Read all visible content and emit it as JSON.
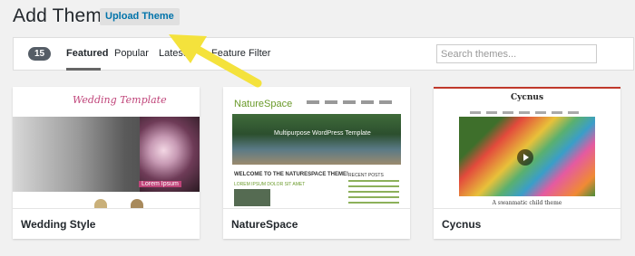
{
  "header": {
    "title": "Add Themes",
    "upload_label": "Upload Theme"
  },
  "filter": {
    "count": "15",
    "tabs": [
      "Featured",
      "Popular",
      "Latest",
      "Feature Filter"
    ],
    "active_tab": "Featured",
    "search_placeholder": "Search themes..."
  },
  "themes": [
    {
      "name": "Wedding Style",
      "preview": {
        "logo": "Wedding Template",
        "caption": "Lorem Ipsum"
      }
    },
    {
      "name": "NatureSpace",
      "preview": {
        "logo": "NatureSpace",
        "hero_text": "Multipurpose WordPress Template",
        "welcome": "WELCOME TO THE NATURESPACE THEME!",
        "post_title": "LOREM IPSUM DOLOR SIT AMET",
        "sidebar_title": "RECENT POSTS"
      }
    },
    {
      "name": "Cycnus",
      "preview": {
        "logo": "Cycnus",
        "footer_caption": "A swanmatic child theme"
      }
    }
  ],
  "colors": {
    "link": "#0073aa",
    "arrow": "#f4e23c",
    "count_badge": "#555d66"
  }
}
